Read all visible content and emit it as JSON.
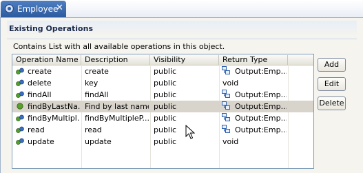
{
  "tab": {
    "title": "Employee",
    "close": "✕"
  },
  "section": {
    "title": "Existing Operations",
    "description": "Contains List with all available operations in this object."
  },
  "table": {
    "columns": [
      "Operation Name",
      "Description",
      "Visibility",
      "Return Type"
    ],
    "rows": [
      {
        "name": "create",
        "description": "create",
        "visibility": "public",
        "return_type": "Output:Emp...",
        "return_icon": "output-icon",
        "selected": false
      },
      {
        "name": "delete",
        "description": "key",
        "visibility": "public",
        "return_type": "void",
        "return_icon": "",
        "selected": false
      },
      {
        "name": "findAll",
        "description": "findAll",
        "visibility": "public",
        "return_type": "Output:Emp...",
        "return_icon": "output-icon",
        "selected": false
      },
      {
        "name": "findByLastNa...",
        "description": "Find by last name",
        "visibility": "public",
        "return_type": "Output:Emp...",
        "return_icon": "output-icon",
        "selected": true
      },
      {
        "name": "findByMultipl...",
        "description": "findByMultipleP...",
        "visibility": "public",
        "return_type": "Output:Emp...",
        "return_icon": "output-icon",
        "selected": false
      },
      {
        "name": "read",
        "description": "read",
        "visibility": "public",
        "return_type": "Output:Emp...",
        "return_icon": "output-icon",
        "selected": false
      },
      {
        "name": "update",
        "description": "update",
        "visibility": "public",
        "return_type": "void",
        "return_icon": "",
        "selected": false
      }
    ]
  },
  "buttons": {
    "add": "Add",
    "edit": "Edit",
    "delete": "Delete"
  },
  "colors": {
    "tab_active": "#2c5aa0",
    "selection": "#d8d4cc",
    "table_border": "#7f9db9"
  }
}
